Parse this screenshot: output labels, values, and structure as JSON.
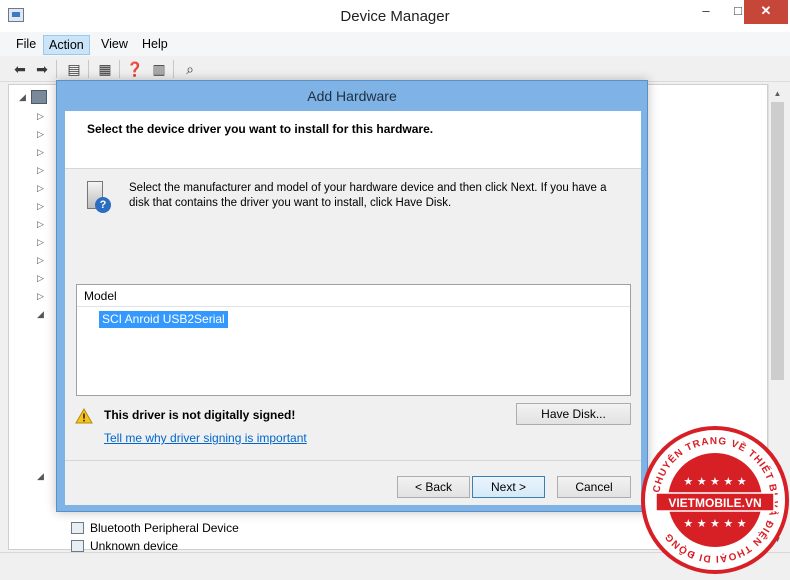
{
  "device_manager": {
    "title": "Device Manager",
    "window_controls": {
      "minimize": "–",
      "maximize": "□",
      "close": "✕"
    },
    "menu": [
      "File",
      "Action",
      "View",
      "Help"
    ],
    "tree_visible_items": [
      "Bluetooth Peripheral Device",
      "Unknown device"
    ]
  },
  "add_hardware": {
    "title": "Add Hardware",
    "header": "Select the device driver you want to install for this hardware.",
    "instructions": "Select the manufacturer and model of your hardware device and then click Next. If you have a disk that contains the driver you want to install, click Have Disk.",
    "model_column": "Model",
    "model_selected": "SCI Anroid USB2Serial",
    "warning": "This driver is not digitally signed!",
    "warning_link": "Tell me why driver signing is important",
    "have_disk": "Have Disk...",
    "back": "< Back",
    "next": "Next >",
    "cancel": "Cancel"
  },
  "watermark": {
    "brand": "VIETMOBILE.VN",
    "ring_text": "CHUYÊN TRANG VỀ THIẾT BỊ VÀ ĐIỆN THOẠI DI ĐỘNG"
  },
  "colors": {
    "dialog_frame": "#7fb3e6",
    "selection": "#3399ff",
    "link": "#0066cc",
    "seal_red": "#d71f26"
  }
}
